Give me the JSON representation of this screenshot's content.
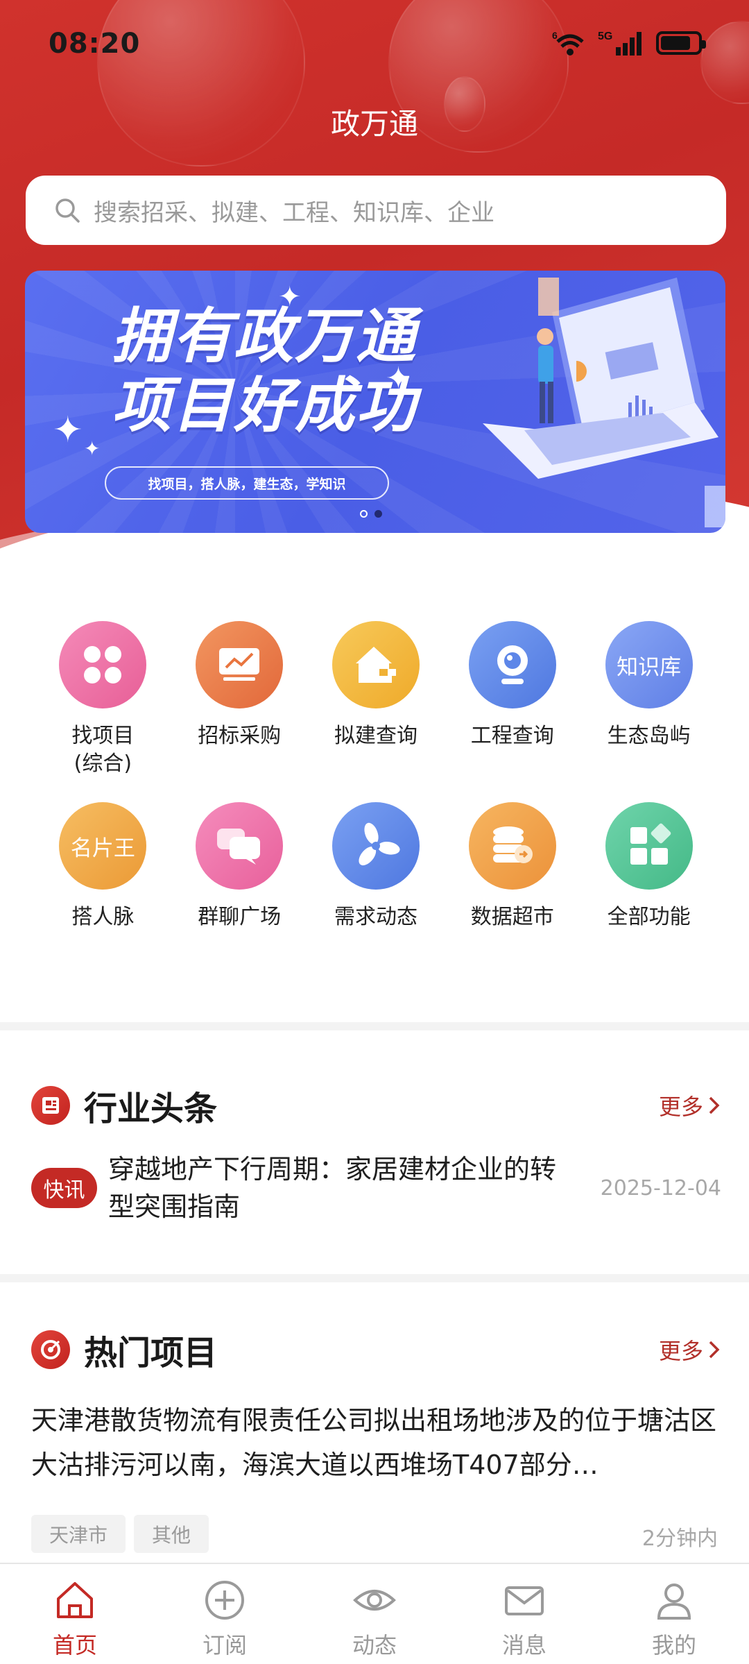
{
  "status_bar": {
    "time": "08:20",
    "network": "5G",
    "wifi_badge": "6"
  },
  "app": {
    "title": "政万通"
  },
  "search": {
    "placeholder": "搜索招采、拟建、工程、知识库、企业"
  },
  "banner": {
    "headline_line1": "拥有政万通",
    "headline_line2": "项目好成功",
    "tagline": "找项目，搭人脉，建生态，学知识",
    "pages": 2,
    "active_page": 2
  },
  "grid": {
    "items": [
      {
        "label_line1": "找项目",
        "label_line2": "(综合)",
        "icon": "clover-icon",
        "color": "#ec6aa0"
      },
      {
        "label_line1": "招标采购",
        "label_line2": "",
        "icon": "chart-screen-icon",
        "color": "#ee7f4d"
      },
      {
        "label_line1": "拟建查询",
        "label_line2": "",
        "icon": "house-icon",
        "color": "#f3b63d"
      },
      {
        "label_line1": "工程查询",
        "label_line2": "",
        "icon": "camera-icon",
        "color": "#5d86e8"
      },
      {
        "label_line1": "生态岛屿",
        "label_line2": "",
        "icon_text": "知识库",
        "icon": "knowledge-icon",
        "color": "#6e8ff0"
      },
      {
        "label_line1": "搭人脉",
        "label_line2": "",
        "icon_text": "名片王",
        "icon": "card-icon",
        "color": "#f0aa4a"
      },
      {
        "label_line1": "群聊广场",
        "label_line2": "",
        "icon": "chat-icon",
        "color": "#ee73a8"
      },
      {
        "label_line1": "需求动态",
        "label_line2": "",
        "icon": "fan-icon",
        "color": "#5f8ae8"
      },
      {
        "label_line1": "数据超市",
        "label_line2": "",
        "icon": "database-icon",
        "color": "#f0a14a"
      },
      {
        "label_line1": "全部功能",
        "label_line2": "",
        "icon": "grid-apps-icon",
        "color": "#57c79a"
      }
    ]
  },
  "industry_news": {
    "title": "行业头条",
    "more": "更多",
    "item": {
      "badge": "快讯",
      "text": "穿越地产下行周期：家居建材企业的转型突围指南",
      "date": "2025-12-04"
    }
  },
  "hot_projects": {
    "title": "热门项目",
    "more": "更多",
    "item": {
      "text": "天津港散货物流有限责任公司拟出租场地涉及的位于塘沽区大沽排污河以南，海滨大道以西堆场T407部分…",
      "tags": [
        "天津市",
        "其他"
      ],
      "time": "2分钟内"
    }
  },
  "bottom_nav": {
    "items": [
      {
        "label": "首页",
        "icon": "home-icon",
        "active": true
      },
      {
        "label": "订阅",
        "icon": "plus-circle-icon",
        "active": false
      },
      {
        "label": "动态",
        "icon": "eye-icon",
        "active": false
      },
      {
        "label": "消息",
        "icon": "mail-icon",
        "active": false
      },
      {
        "label": "我的",
        "icon": "user-icon",
        "active": false
      }
    ]
  },
  "colors": {
    "brand_red": "#c42a25",
    "banner_blue": "#4a5ee6",
    "more_red": "#b2302a"
  }
}
